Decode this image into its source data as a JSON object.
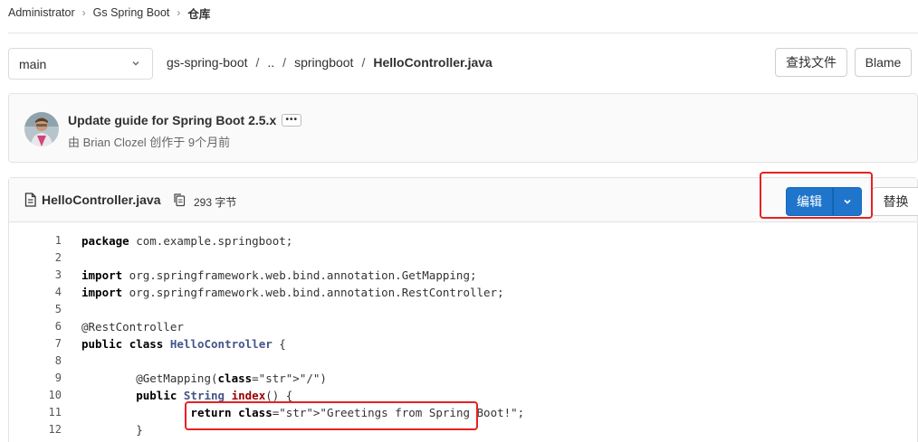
{
  "breadcrumb": {
    "items": [
      "Administrator",
      "Gs Spring Boot",
      "仓库"
    ]
  },
  "branch": {
    "selected": "main"
  },
  "path": {
    "segments": [
      "gs-spring-boot",
      "..",
      "springboot"
    ],
    "file": "HelloController.java"
  },
  "actions": {
    "find_file": "查找文件",
    "blame": "Blame"
  },
  "commit": {
    "title": "Update guide for Spring Boot 2.5.x",
    "more": "•••",
    "meta": "由 Brian Clozel 创作于 9个月前"
  },
  "file": {
    "name": "HelloController.java",
    "size": "293 字节",
    "edit_label": "编辑",
    "replace_label": "替换"
  },
  "code_lines": [
    {
      "n": "1",
      "t": "package com.example.springboot;"
    },
    {
      "n": "2",
      "t": ""
    },
    {
      "n": "3",
      "t": "import org.springframework.web.bind.annotation.GetMapping;"
    },
    {
      "n": "4",
      "t": "import org.springframework.web.bind.annotation.RestController;"
    },
    {
      "n": "5",
      "t": ""
    },
    {
      "n": "6",
      "t": "@RestController"
    },
    {
      "n": "7",
      "t": "public class HelloController {"
    },
    {
      "n": "8",
      "t": ""
    },
    {
      "n": "9",
      "t": "        @GetMapping(\"/\")"
    },
    {
      "n": "10",
      "t": "        public String index() {"
    },
    {
      "n": "11",
      "t": "                return \"Greetings from Spring Boot!\";"
    },
    {
      "n": "12",
      "t": "        }"
    }
  ],
  "colors": {
    "primary": "#1f75cb",
    "highlight": "#e62222"
  }
}
